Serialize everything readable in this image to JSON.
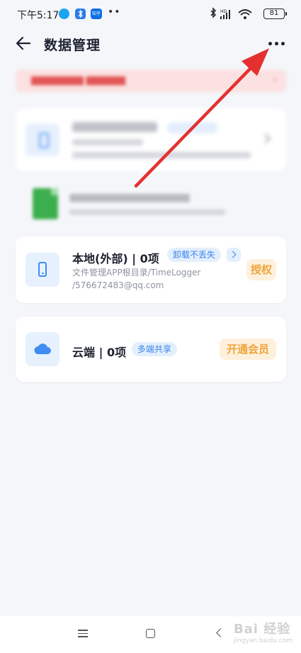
{
  "status_bar": {
    "time": "下午5:17",
    "app_badges": [
      "",
      "",
      "知乎"
    ],
    "dots": "••",
    "battery": "81"
  },
  "header": {
    "title": "数据管理"
  },
  "local_card": {
    "title": "本地(外部) | 0项",
    "tag": "卸载不丢失",
    "path_line1": "文件管理APP根目录/TimeLogger",
    "path_line2": "/576672483@qq.com",
    "action": "授权"
  },
  "cloud_card": {
    "title": "云端 | 0项",
    "tag": "多端共享",
    "action": "开通会员"
  },
  "watermark": {
    "text": "Bai 经验",
    "sub": "jingyan.baidu.com"
  },
  "colors": {
    "accent_blue": "#3a84ea",
    "action_orange": "#f0a43a",
    "annotation_red": "#e53030"
  }
}
